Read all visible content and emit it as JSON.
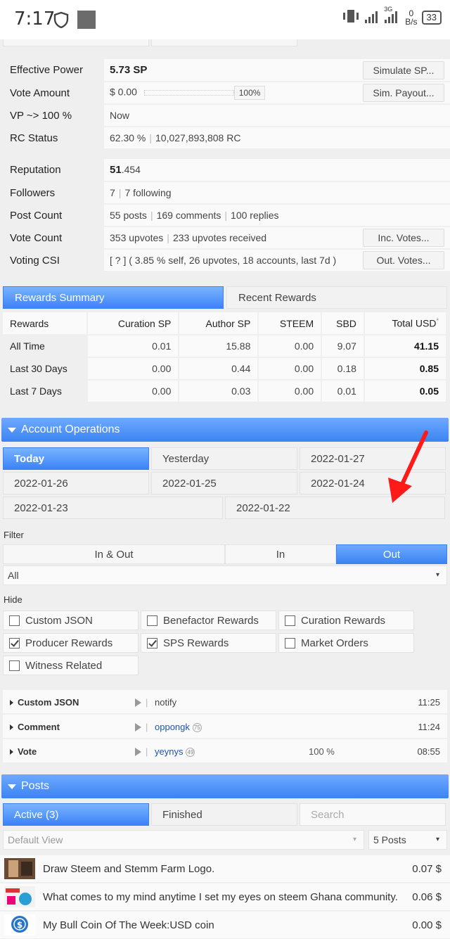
{
  "status_bar": {
    "time": "7:17",
    "network": "3G",
    "speed_value": "0",
    "speed_unit": "B/s",
    "battery": "33"
  },
  "account_stats": [
    {
      "label": "Effective Power",
      "value": "5.73 SP",
      "button": "Simulate SP..."
    },
    {
      "label": "Vote Amount",
      "value": "$ 0.00",
      "slider_pct": "100%",
      "slider_fraction": 1.0,
      "button": "Sim. Payout..."
    },
    {
      "label": "VP ~> 100 %",
      "value": "Now"
    },
    {
      "label": "RC Status",
      "value_a": "62.30 %",
      "value_b": "10,027,893,808 RC"
    }
  ],
  "social_stats": {
    "reputation": {
      "label": "Reputation",
      "int": "51",
      "dec": ".454"
    },
    "followers": {
      "label": "Followers",
      "a": "7",
      "b": "7 following"
    },
    "post_count": {
      "label": "Post Count",
      "a": "55 posts",
      "b": "169 comments",
      "c": "100 replies"
    },
    "vote_count": {
      "label": "Vote Count",
      "a": "353 upvotes",
      "b": "233 upvotes received",
      "button": "Inc. Votes..."
    },
    "voting_csi": {
      "label": "Voting CSI",
      "value": "[ ? ] ( 3.85 % self, 26 upvotes, 18 accounts, last 7d )",
      "button": "Out. Votes..."
    }
  },
  "rewards_tabs": [
    "Rewards Summary",
    "Recent Rewards"
  ],
  "rewards_table": {
    "headers": [
      "Rewards",
      "Curation SP",
      "Author SP",
      "STEEM",
      "SBD",
      "Total USD"
    ],
    "total_marker": "*",
    "rows": [
      {
        "label": "All Time",
        "cur": "0.01",
        "auth": "15.88",
        "steem": "0.00",
        "sbd": "9.07",
        "total": "41.15"
      },
      {
        "label": "Last 30 Days",
        "cur": "0.00",
        "auth": "0.44",
        "steem": "0.00",
        "sbd": "0.18",
        "total": "0.85"
      },
      {
        "label": "Last 7 Days",
        "cur": "0.00",
        "auth": "0.03",
        "steem": "0.00",
        "sbd": "0.01",
        "total": "0.05"
      }
    ]
  },
  "account_operations": {
    "title": "Account Operations",
    "days": [
      "Today",
      "Yesterday",
      "2022-01-27",
      "2022-01-26",
      "2022-01-25",
      "2022-01-24",
      "2022-01-23",
      "2022-01-22"
    ],
    "filter_label": "Filter",
    "filter_options": [
      "In & Out",
      "In",
      "Out"
    ],
    "type_select": "All",
    "hide_label": "Hide",
    "hide_options": [
      {
        "label": "Custom JSON",
        "checked": false
      },
      {
        "label": "Benefactor Rewards",
        "checked": false
      },
      {
        "label": "Curation Rewards",
        "checked": false
      },
      {
        "label": "Producer Rewards",
        "checked": true
      },
      {
        "label": "SPS Rewards",
        "checked": true
      },
      {
        "label": "Market Orders",
        "checked": false
      },
      {
        "label": "Witness Related",
        "checked": false
      }
    ],
    "ops": [
      {
        "type": "Custom JSON",
        "who": "notify",
        "rep": "",
        "pct": "",
        "time": "11:25"
      },
      {
        "type": "Comment",
        "who": "oppongk",
        "rep": "75",
        "pct": "",
        "time": "11:24"
      },
      {
        "type": "Vote",
        "who": "yeynys",
        "rep": "49",
        "pct": "100 %",
        "time": "08:55"
      }
    ]
  },
  "posts": {
    "title": "Posts",
    "tabs": [
      "Active (3)",
      "Finished"
    ],
    "search_placeholder": "Search",
    "view_select": "Default View",
    "count_select": "5 Posts",
    "items": [
      {
        "title": "Draw Steem and Stemm Farm Logo.",
        "payout": "0.07 $"
      },
      {
        "title": "What comes to my mind anytime I set my eyes on steem Ghana community.",
        "payout": "0.06 $"
      },
      {
        "title": "My Bull Coin Of The Week:USD coin",
        "payout": "0.00 $"
      }
    ]
  },
  "colors": {
    "accent": "#3b82f6",
    "annotation_arrow": "#ff0000"
  }
}
